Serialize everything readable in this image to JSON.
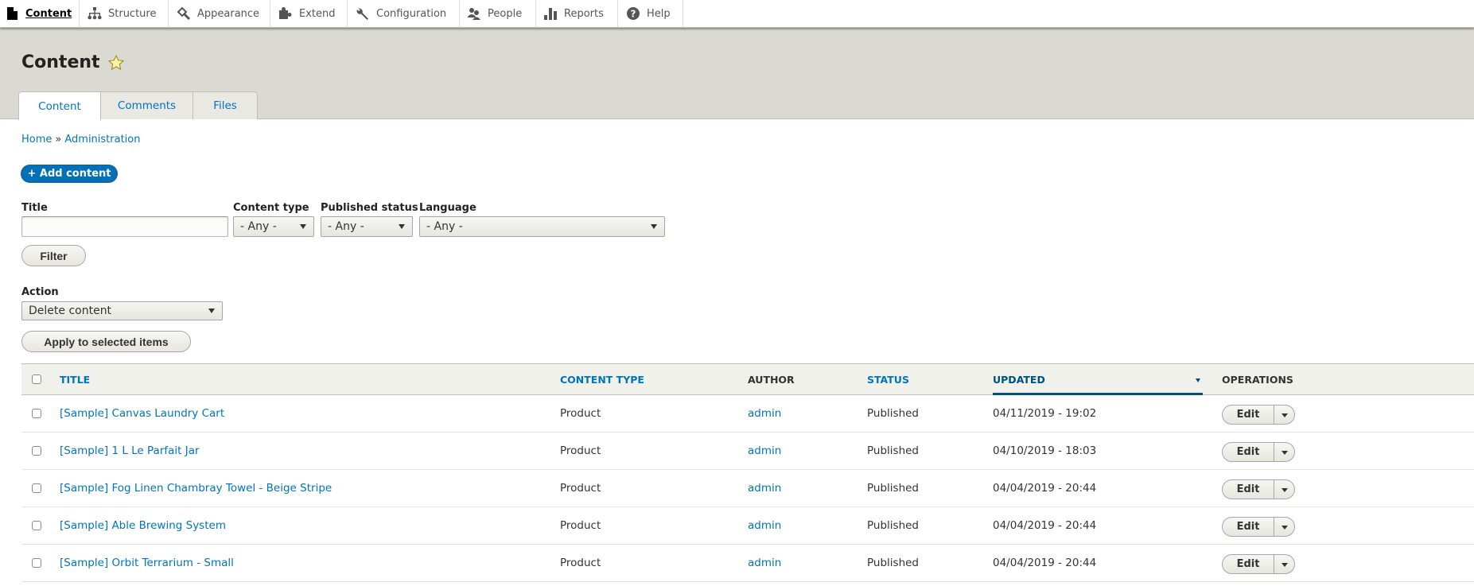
{
  "toolbar": {
    "items": [
      {
        "label": "Content",
        "icon": "file-icon",
        "active": true
      },
      {
        "label": "Structure",
        "icon": "sitemap-icon"
      },
      {
        "label": "Appearance",
        "icon": "paintbrush-icon"
      },
      {
        "label": "Extend",
        "icon": "puzzle-icon"
      },
      {
        "label": "Configuration",
        "icon": "wrench-icon"
      },
      {
        "label": "People",
        "icon": "people-icon"
      },
      {
        "label": "Reports",
        "icon": "bar-chart-icon"
      },
      {
        "label": "Help",
        "icon": "question-icon"
      }
    ]
  },
  "header": {
    "title": "Content",
    "tabs": [
      {
        "label": "Content",
        "active": true
      },
      {
        "label": "Comments"
      },
      {
        "label": "Files"
      }
    ]
  },
  "breadcrumb": {
    "items": [
      "Home",
      "Administration"
    ],
    "separator": "»"
  },
  "add_content_label": "+ Add content",
  "filters": {
    "title": {
      "label": "Title",
      "value": ""
    },
    "content_type": {
      "label": "Content type",
      "value": "- Any -"
    },
    "published_status": {
      "label": "Published status",
      "value": "- Any -"
    },
    "language": {
      "label": "Language",
      "value": "- Any -"
    },
    "filter_button": "Filter"
  },
  "bulk": {
    "label": "Action",
    "value": "Delete content",
    "apply_button": "Apply to selected items"
  },
  "table": {
    "columns": {
      "title": "TITLE",
      "content_type": "CONTENT TYPE",
      "author": "AUTHOR",
      "status": "STATUS",
      "updated": "UPDATED",
      "operations": "OPERATIONS"
    },
    "sorted_by": "updated",
    "sort_direction": "desc",
    "edit_label": "Edit",
    "rows": [
      {
        "title": "[Sample] Canvas Laundry Cart",
        "type": "Product",
        "author": "admin",
        "status": "Published",
        "updated": "04/11/2019 - 19:02"
      },
      {
        "title": "[Sample] 1 L Le Parfait Jar",
        "type": "Product",
        "author": "admin",
        "status": "Published",
        "updated": "04/10/2019 - 18:03"
      },
      {
        "title": "[Sample] Fog Linen Chambray Towel - Beige Stripe",
        "type": "Product",
        "author": "admin",
        "status": "Published",
        "updated": "04/04/2019 - 20:44"
      },
      {
        "title": "[Sample] Able Brewing System",
        "type": "Product",
        "author": "admin",
        "status": "Published",
        "updated": "04/04/2019 - 20:44"
      },
      {
        "title": "[Sample] Orbit Terrarium - Small",
        "type": "Product",
        "author": "admin",
        "status": "Published",
        "updated": "04/04/2019 - 20:44"
      }
    ]
  },
  "colors": {
    "link": "#0074bd",
    "primary_button": "#0071b8",
    "header_bg": "#dbdad2",
    "sorted_header": "#004f80"
  }
}
